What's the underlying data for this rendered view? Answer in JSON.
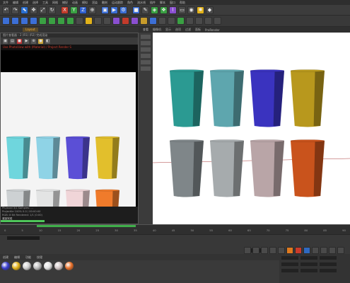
{
  "window": {
    "menu": [
      "文件",
      "编辑",
      "创建",
      "选择",
      "工具",
      "网格",
      "捕捉",
      "动画",
      "模拟",
      "渲染",
      "雕刻",
      "运动跟踪",
      "角色",
      "流水线",
      "插件",
      "脚本",
      "窗口",
      "帮助"
    ]
  },
  "toolbar_icons": [
    "undo-icon",
    "redo-icon",
    "select-icon",
    "move-icon",
    "scale-icon",
    "rotate-icon",
    "axis-x-icon",
    "axis-y-icon",
    "axis-z-icon",
    "world-icon",
    "render-view-icon",
    "render-icon",
    "render-settings-icon",
    "cube-icon",
    "pen-icon",
    "subdivide-icon",
    "cloner-icon",
    "deformer-icon",
    "floor-icon",
    "camera-icon",
    "light-icon",
    "tag-icon"
  ],
  "picture_viewer": {
    "title": "图片查看器 - 2 (R1) (R2) 完成渲染",
    "log": "Use PhotoView with (Material) / Project Render S",
    "info_lines": [
      "Physical 3/1 Samples: ...",
      "Projectile 100% 0.0 / 00:00:00",
      "RGB: 8 Bit Rendered: 1/1 (0:00)",
      "Frame: 0 / Ready"
    ],
    "status": "渲染完成"
  },
  "viewport": {
    "header": [
      "查看",
      "摄像机",
      "显示",
      "选项",
      "过滤",
      "面板",
      "ProRender"
    ],
    "grid_label": "网格间距: 100 cm"
  },
  "timeline": {
    "ticks": [
      "0",
      "5",
      "10",
      "15",
      "20",
      "25",
      "30",
      "35",
      "40",
      "45",
      "50",
      "55",
      "60",
      "65",
      "70",
      "75",
      "80",
      "85",
      "90"
    ],
    "frame_field": "0 F",
    "end_field": "90 F"
  },
  "materials": {
    "menu": [
      "创建",
      "编辑",
      "功能",
      "纹理"
    ],
    "swatch_colors": [
      "#3a3fd0",
      "#e2b21a",
      "#cfcfcf",
      "#bdbdbd",
      "#e0e0e0",
      "#d0c4c4",
      "#e8702a"
    ]
  },
  "render_cups": {
    "row1": [
      "#6fd6dd",
      "#8fd3e6",
      "#5b4fd6",
      "#e2bf2c"
    ],
    "row2": [
      "#cdd1d3",
      "#e3e4e4",
      "#f0d5d8",
      "#f07b2b"
    ]
  },
  "viewport_cups": {
    "row1": [
      "#2b9a92",
      "#5ea6ae",
      "#3a33bf",
      "#b8981d"
    ],
    "row2": [
      "#7f8689",
      "#a6abad",
      "#b9a5a7",
      "#c9531c"
    ]
  }
}
